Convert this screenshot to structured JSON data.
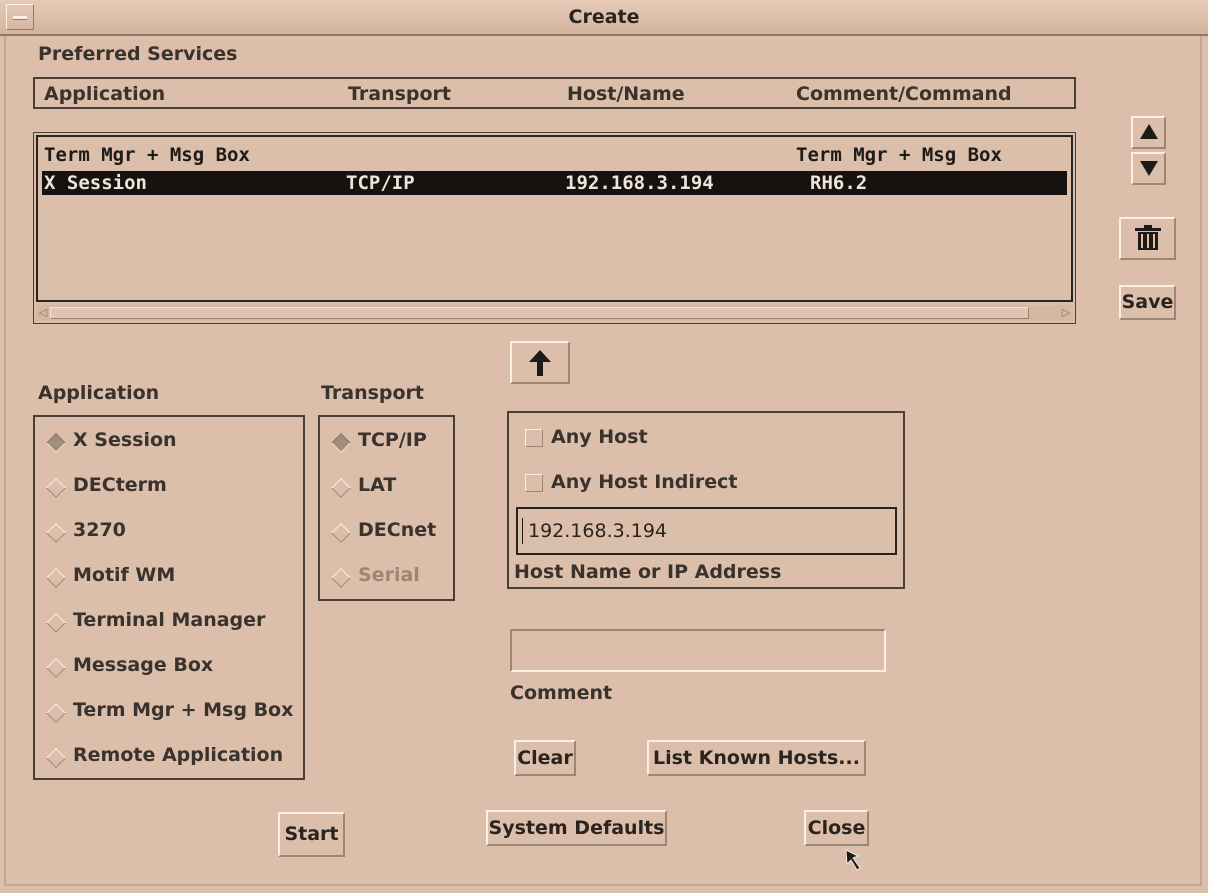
{
  "window": {
    "title": "Create"
  },
  "preferred_services": {
    "label": "Preferred Services",
    "columns": [
      "Application",
      "Transport",
      "Host/Name",
      "Comment/Command"
    ],
    "rows": [
      {
        "application": "Term Mgr + Msg Box",
        "transport": "",
        "host": "",
        "comment": "Term Mgr + Msg Box",
        "selected": false
      },
      {
        "application": "X Session",
        "transport": "TCP/IP",
        "host": "192.168.3.194",
        "comment": "RH6.2",
        "selected": true
      }
    ]
  },
  "side_buttons": {
    "up_icon": "triangle-up-icon",
    "down_icon": "triangle-down-icon",
    "delete_icon": "trash-can-icon",
    "save_label": "Save"
  },
  "add_up_icon": "arrow-up-icon",
  "application": {
    "label": "Application",
    "options": [
      "X Session",
      "DECterm",
      "3270",
      "Motif WM",
      "Terminal Manager",
      "Message Box",
      "Term Mgr + Msg Box",
      "Remote Application"
    ],
    "selected": "X Session"
  },
  "transport": {
    "label": "Transport",
    "options": [
      "TCP/IP",
      "LAT",
      "DECnet",
      "Serial"
    ],
    "selected": "TCP/IP",
    "disabled": [
      "Serial"
    ]
  },
  "host": {
    "any_host_label": "Any Host",
    "any_host_indirect_label": "Any Host Indirect",
    "value": "192.168.3.194",
    "field_label": "Host Name or IP Address"
  },
  "comment": {
    "value": "",
    "label": "Comment"
  },
  "buttons": {
    "clear": "Clear",
    "list_known_hosts": "List Known Hosts...",
    "start": "Start",
    "system_defaults": "System Defaults",
    "close": "Close"
  }
}
